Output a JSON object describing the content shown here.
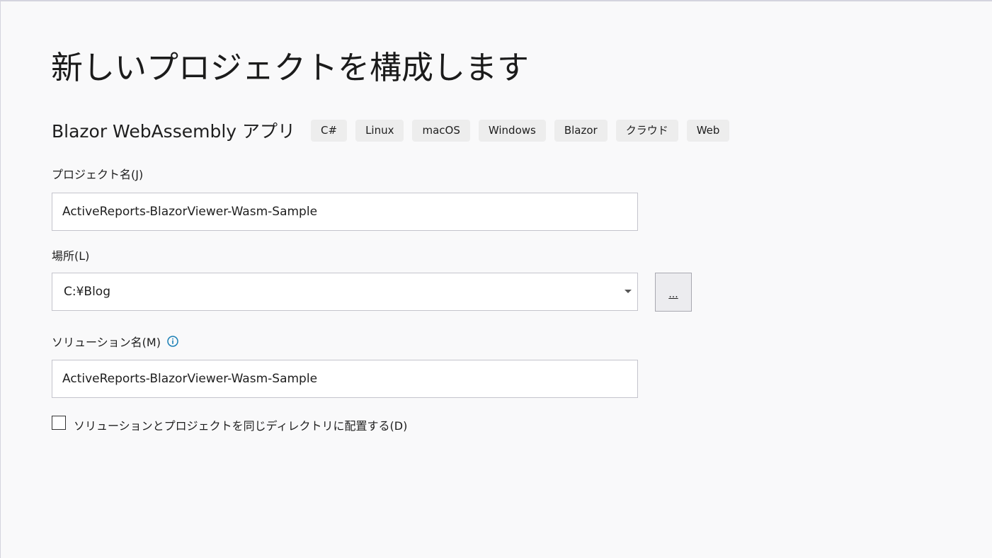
{
  "page": {
    "title": "新しいプロジェクトを構成します"
  },
  "template": {
    "name": "Blazor WebAssembly アプリ",
    "tags": [
      "C#",
      "Linux",
      "macOS",
      "Windows",
      "Blazor",
      "クラウド",
      "Web"
    ]
  },
  "project_name": {
    "label": "プロジェクト名(J)",
    "value": "ActiveReports-BlazorViewer-Wasm-Sample"
  },
  "location": {
    "label": "場所(L)",
    "value": "C:¥Blog",
    "browse_label": "..."
  },
  "solution_name": {
    "label": "ソリューション名(M)",
    "value": "ActiveReports-BlazorViewer-Wasm-Sample",
    "info_icon": "info-icon"
  },
  "same_directory": {
    "label": "ソリューションとプロジェクトを同じディレクトリに配置する(D)",
    "checked": false
  },
  "colors": {
    "background": "#f9f9fa",
    "tag_background": "#ededed",
    "info_icon": "#1a7fb5",
    "input_border": "#c4c4cc"
  }
}
